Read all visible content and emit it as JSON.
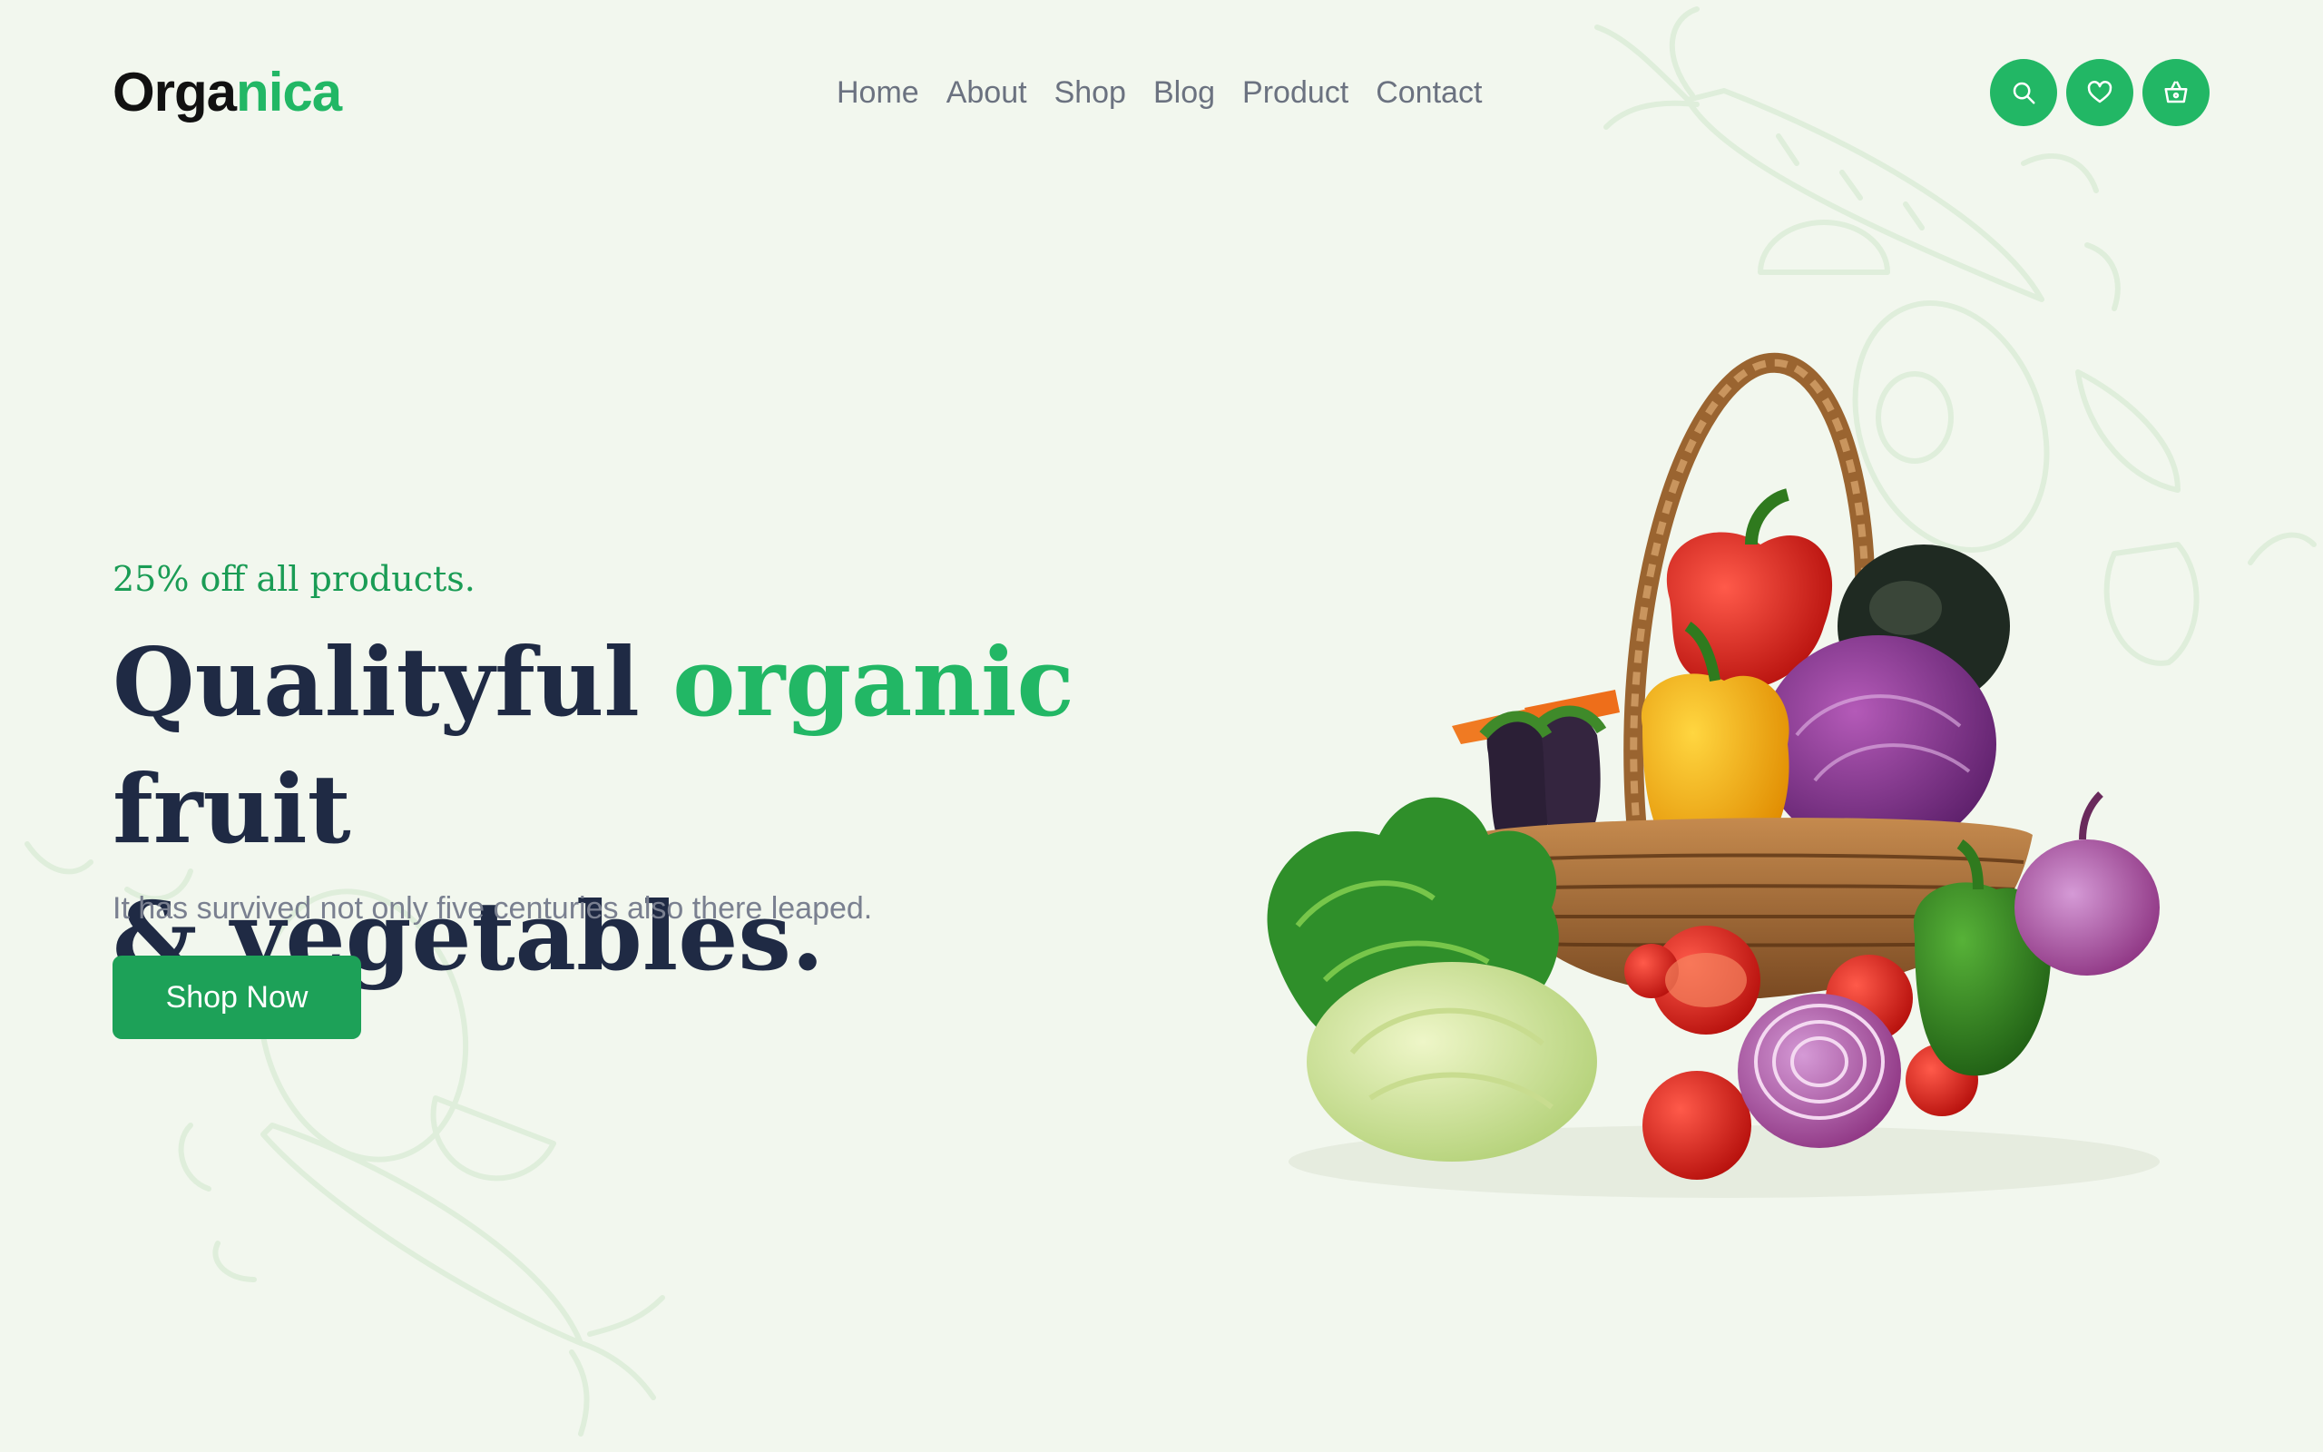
{
  "brand": {
    "part1": "Orga",
    "part2": "nica"
  },
  "nav": {
    "items": [
      "Home",
      "About",
      "Shop",
      "Blog",
      "Product",
      "Contact"
    ]
  },
  "header_icons": [
    "search-icon",
    "heart-icon",
    "basket-icon"
  ],
  "hero": {
    "promo": "25% off all products.",
    "headline_1": "Qualityful ",
    "headline_highlight": "organic",
    "headline_2": " fruit",
    "headline_3": "& vegetables.",
    "description": "It has survived not only five centuries also there leaped.",
    "cta_label": "Shop Now"
  },
  "colors": {
    "background": "#f2f7ee",
    "accent": "#22b765",
    "button": "#1da158",
    "heading": "#1f2a44",
    "nav_text": "#6b7280"
  }
}
